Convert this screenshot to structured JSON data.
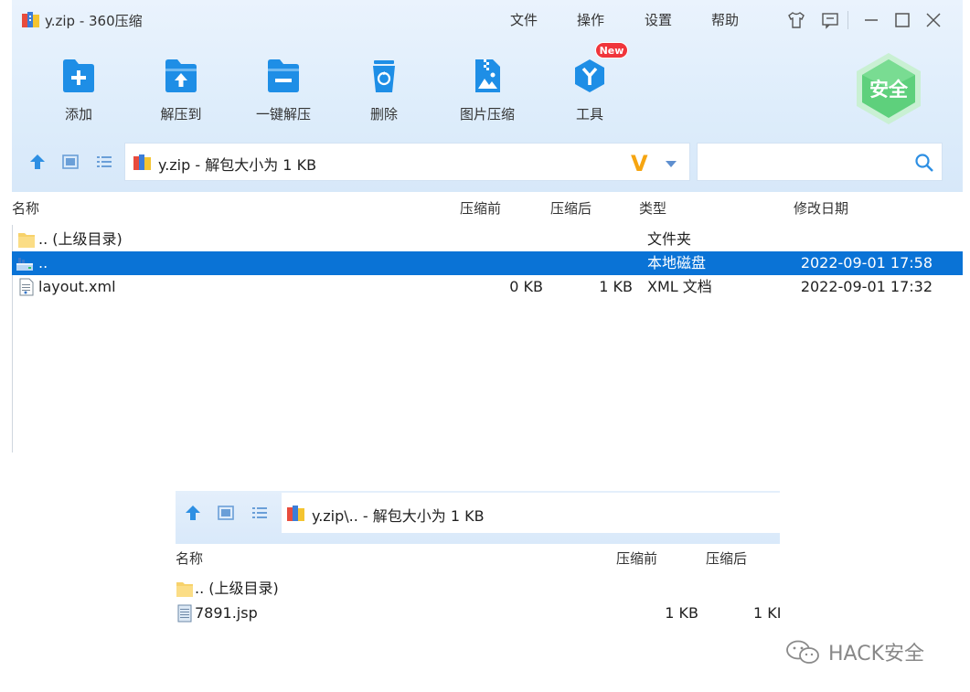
{
  "window": {
    "title": "y.zip - 360压缩",
    "menu": [
      "文件",
      "操作",
      "设置",
      "帮助"
    ],
    "toolbar": [
      {
        "label": "添加",
        "icon": "add-file-icon"
      },
      {
        "label": "解压到",
        "icon": "extract-to-icon"
      },
      {
        "label": "一键解压",
        "icon": "one-click-extract-icon"
      },
      {
        "label": "删除",
        "icon": "delete-icon"
      },
      {
        "label": "图片压缩",
        "icon": "image-compress-icon"
      },
      {
        "label": "工具",
        "icon": "tools-icon",
        "badge": "New"
      }
    ],
    "safe_badge": "安全",
    "path": "y.zip - 解包大小为 1 KB",
    "search_placeholder": "",
    "columns": {
      "name": "名称",
      "before": "压缩前",
      "after": "压缩后",
      "type": "类型",
      "modified": "修改日期"
    },
    "rows": [
      {
        "name": ".. (上级目录)",
        "before": "",
        "after": "",
        "type": "文件夹",
        "modified": "",
        "icon": "folder-icon"
      },
      {
        "name": "..",
        "before": "",
        "after": "",
        "type": "本地磁盘",
        "modified": "2022-09-01 17:58",
        "icon": "drive-icon",
        "selected": true
      },
      {
        "name": "layout.xml",
        "before": "0 KB",
        "after": "1 KB",
        "type": "XML 文档",
        "modified": "2022-09-01 17:32",
        "icon": "xml-file-icon"
      }
    ]
  },
  "window2": {
    "path": "y.zip\\.. - 解包大小为 1 KB",
    "columns": {
      "name": "名称",
      "before": "压缩前",
      "after": "压缩后"
    },
    "rows": [
      {
        "name": ".. (上级目录)",
        "before": "",
        "after": "",
        "icon": "folder-icon"
      },
      {
        "name": "7891.jsp",
        "before": "1 KB",
        "after": "1 KI",
        "icon": "text-file-icon"
      }
    ]
  },
  "watermark": "HACK安全",
  "colors": {
    "accent": "#1e8ee6",
    "selection": "#0a73d6",
    "badge": "#f0353b",
    "safe": "#5ed07c"
  }
}
